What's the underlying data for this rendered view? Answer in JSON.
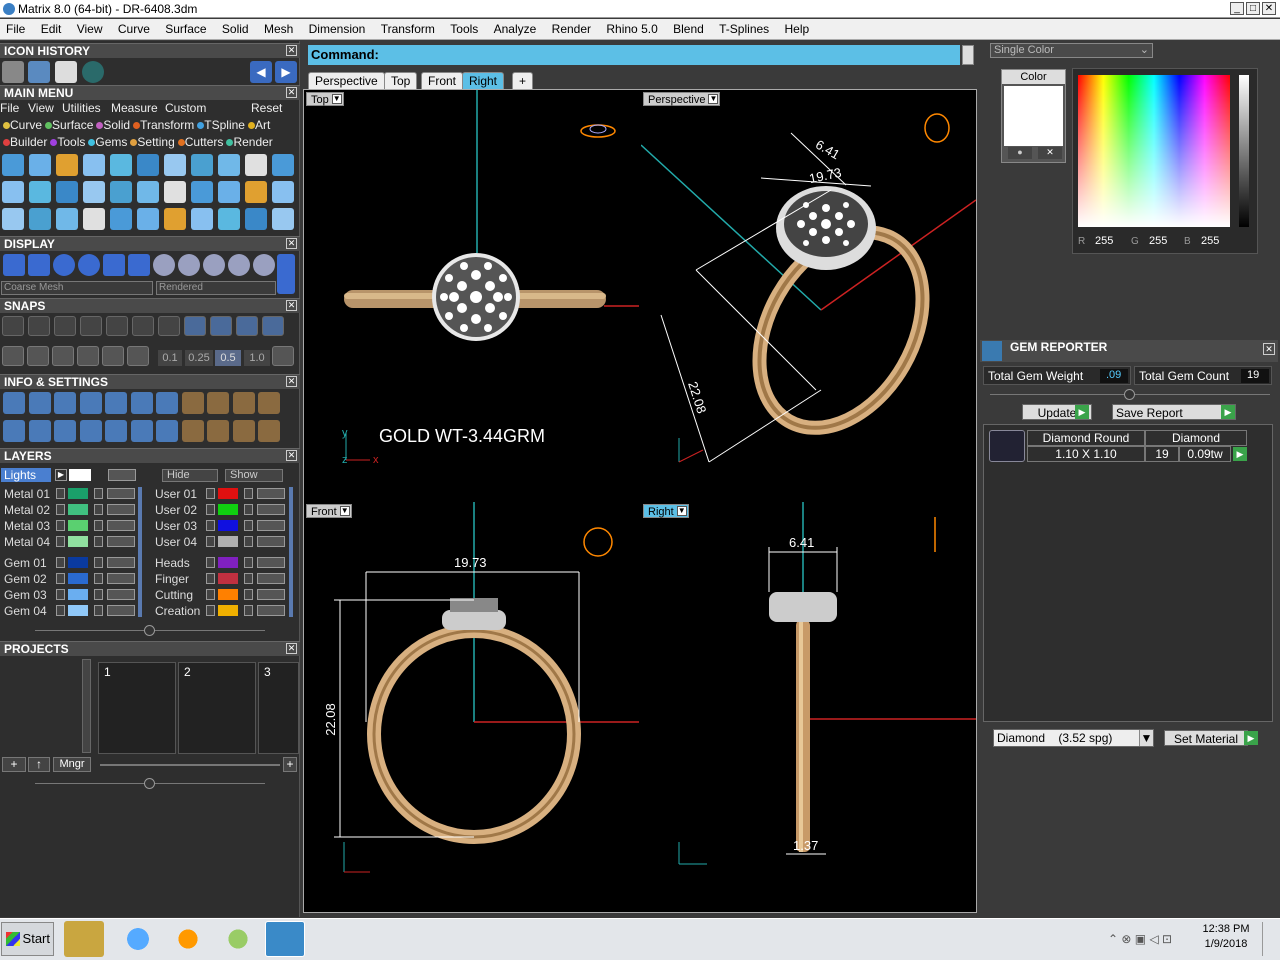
{
  "window": {
    "title": "Matrix 8.0 (64-bit) - DR-6408.3dm",
    "min": "_",
    "max": "□",
    "close": "✕"
  },
  "menubar": [
    "File",
    "Edit",
    "View",
    "Curve",
    "Surface",
    "Solid",
    "Mesh",
    "Dimension",
    "Transform",
    "Tools",
    "Analyze",
    "Render",
    "Rhino 5.0",
    "Blend",
    "T-Splines",
    "Help"
  ],
  "panels": {
    "icon_history": "ICON HISTORY",
    "main_menu": "MAIN MENU",
    "display": "DISPLAY",
    "snaps": "SNAPS",
    "info_settings": "INFO & SETTINGS",
    "layers": "LAYERS",
    "projects": "PROJECTS",
    "close": "✕"
  },
  "main_menu_row1": [
    "File",
    "View",
    "Utilities",
    "Measure",
    "Custom",
    "Reset"
  ],
  "main_menu_row2": [
    {
      "label": "Curve",
      "color": "#e0c040"
    },
    {
      "label": "Surface",
      "color": "#60c060"
    },
    {
      "label": "Solid",
      "color": "#c060c0"
    },
    {
      "label": "Transform",
      "color": "#e06020"
    },
    {
      "label": "TSpline",
      "color": "#40a0e0"
    },
    {
      "label": "Art",
      "color": "#e0b020"
    }
  ],
  "main_menu_row3": [
    {
      "label": "Builder",
      "color": "#e04040"
    },
    {
      "label": "Tools",
      "color": "#a040e0"
    },
    {
      "label": "Gems",
      "color": "#40c0e0"
    },
    {
      "label": "Setting",
      "color": "#e0a040"
    },
    {
      "label": "Cutters",
      "color": "#e07020"
    },
    {
      "label": "Render",
      "color": "#40c0a0"
    }
  ],
  "display": {
    "mesh": "Coarse Mesh",
    "mode": "Rendered"
  },
  "snaps_values": [
    "0.1",
    "0.25",
    "0.5",
    "1.0"
  ],
  "layers": {
    "lights": "Lights",
    "hide": "Hide",
    "show": "Show",
    "left": [
      {
        "name": "Metal 01",
        "color": "#1aa06a"
      },
      {
        "name": "Metal 02",
        "color": "#40c080"
      },
      {
        "name": "Metal 03",
        "color": "#5ad070"
      },
      {
        "name": "Metal 04",
        "color": "#90e0a0"
      },
      {
        "name": "Gem 01",
        "color": "#0a3aa0"
      },
      {
        "name": "Gem 02",
        "color": "#2a6ad0"
      },
      {
        "name": "Gem 03",
        "color": "#6aaef0"
      },
      {
        "name": "Gem 04",
        "color": "#90c8f8"
      }
    ],
    "right": [
      {
        "name": "User 01",
        "color": "#e01010"
      },
      {
        "name": "User 02",
        "color": "#10d010"
      },
      {
        "name": "User 03",
        "color": "#1010e0"
      },
      {
        "name": "User 04",
        "color": "#b0b0b0"
      },
      {
        "name": "Heads",
        "color": "#8020c0"
      },
      {
        "name": "Finger",
        "color": "#c03040"
      },
      {
        "name": "Cutting",
        "color": "#ff8000"
      },
      {
        "name": "Creation",
        "color": "#f0b000"
      }
    ]
  },
  "projects": {
    "slots": [
      "1",
      "2",
      "3"
    ],
    "mngr": "Mngr"
  },
  "command": {
    "label": "Command:"
  },
  "viewport_tabs": [
    "Perspective",
    "Top",
    "Front",
    "Right",
    "+"
  ],
  "active_tab": "Right",
  "viewports": {
    "top": {
      "label": "Top",
      "annotation": "GOLD WT-3.44GRM"
    },
    "perspective": {
      "label": "Perspective",
      "dims": [
        "6.41",
        "19.73",
        "22.08"
      ]
    },
    "front": {
      "label": "Front",
      "dims": [
        "19.73",
        "22.08"
      ]
    },
    "right": {
      "label": "Right",
      "dims": [
        "6.41",
        "1.37"
      ]
    },
    "axes": {
      "x": "x",
      "y": "y",
      "z": "z"
    }
  },
  "color_panel": {
    "mode": "Single Color",
    "title": "Color",
    "r_label": "R",
    "g_label": "G",
    "b_label": "B",
    "r": "255",
    "g": "255",
    "b": "255"
  },
  "gem_reporter": {
    "title": "GEM REPORTER",
    "total_weight_label": "Total Gem Weight",
    "total_weight": ".09",
    "total_count_label": "Total Gem Count",
    "total_count": "19",
    "update": "Update",
    "save_report": "Save Report",
    "row": {
      "shape": "Diamond Round",
      "type": "Diamond",
      "size": "1.10 X 1.10",
      "count": "19",
      "weight": "0.09tw"
    },
    "material": "Diamond    (3.52 spg)",
    "set_material": "Set Material"
  },
  "taskbar": {
    "start": "Start",
    "time": "12:38 PM",
    "date": "1/9/2018"
  }
}
